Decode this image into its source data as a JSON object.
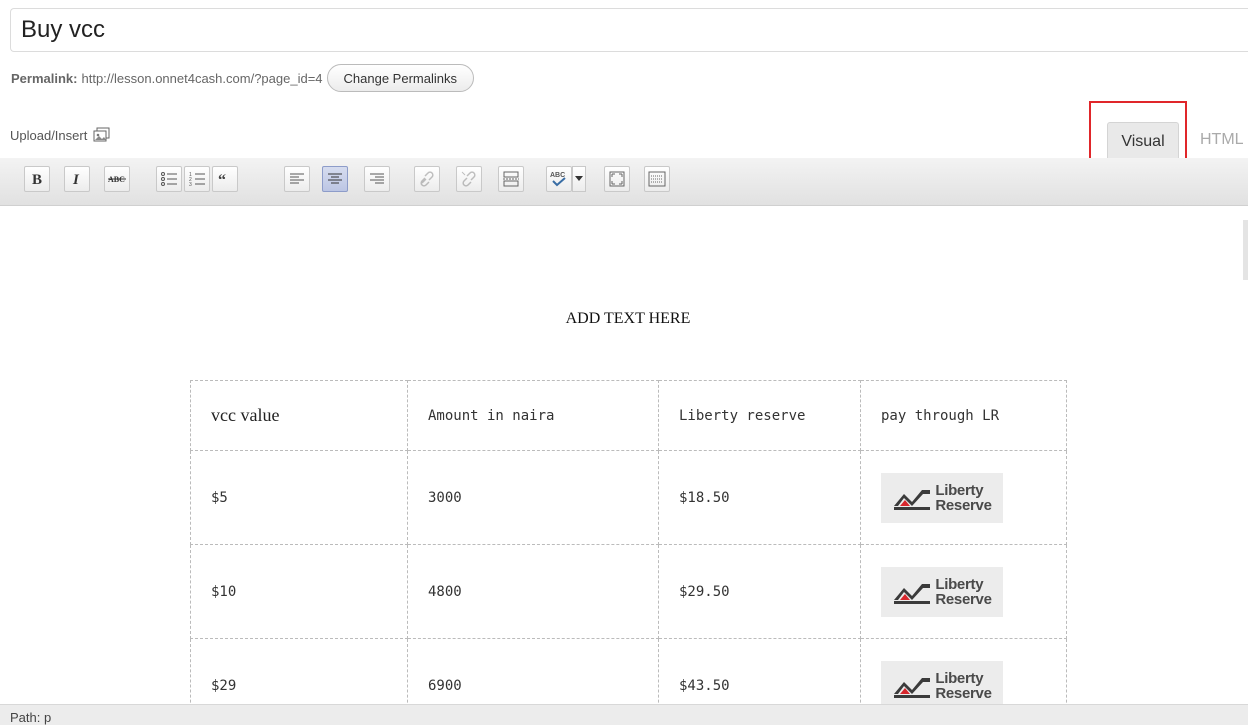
{
  "post": {
    "title": "Buy vcc"
  },
  "permalink": {
    "label": "Permalink:",
    "url": "http://lesson.onnet4cash.com/?page_id=4",
    "change_button": "Change Permalinks"
  },
  "upload": {
    "label": "Upload/Insert",
    "icon": "media-gallery-icon"
  },
  "tabs": {
    "visual": "Visual",
    "html": "HTML",
    "active": "Visual"
  },
  "toolbar": {
    "buttons": [
      {
        "name": "bold",
        "glyph": "B"
      },
      {
        "name": "italic",
        "glyph": "I"
      },
      {
        "name": "strikethrough",
        "glyph": "ABC"
      },
      {
        "name": "bullet-list"
      },
      {
        "name": "numbered-list"
      },
      {
        "name": "blockquote",
        "glyph": "66"
      },
      {
        "name": "align-left"
      },
      {
        "name": "align-center",
        "active": true
      },
      {
        "name": "align-right"
      },
      {
        "name": "insert-link"
      },
      {
        "name": "remove-link"
      },
      {
        "name": "insert-more"
      },
      {
        "name": "spellcheck",
        "glyph": "ABC"
      },
      {
        "name": "fullscreen"
      },
      {
        "name": "kitchen-sink"
      }
    ]
  },
  "editor": {
    "add_text": "ADD TEXT HERE",
    "table": {
      "headers": [
        "vcc value",
        "Amount in naira",
        "Liberty reserve",
        "pay through LR"
      ],
      "rows": [
        {
          "vcc": "$5",
          "naira": "3000",
          "lr": "$18.50"
        },
        {
          "vcc": "$10",
          "naira": "4800",
          "lr": "$29.50"
        },
        {
          "vcc": "$29",
          "naira": "6900",
          "lr": "$43.50"
        }
      ],
      "logo": {
        "line1": "Liberty",
        "line2": "Reserve",
        "accent": "#d7262c"
      }
    }
  },
  "status": {
    "path": "Path: p"
  },
  "colors": {
    "highlight": "#e0262a",
    "toolbar": "#e8e8e8"
  }
}
